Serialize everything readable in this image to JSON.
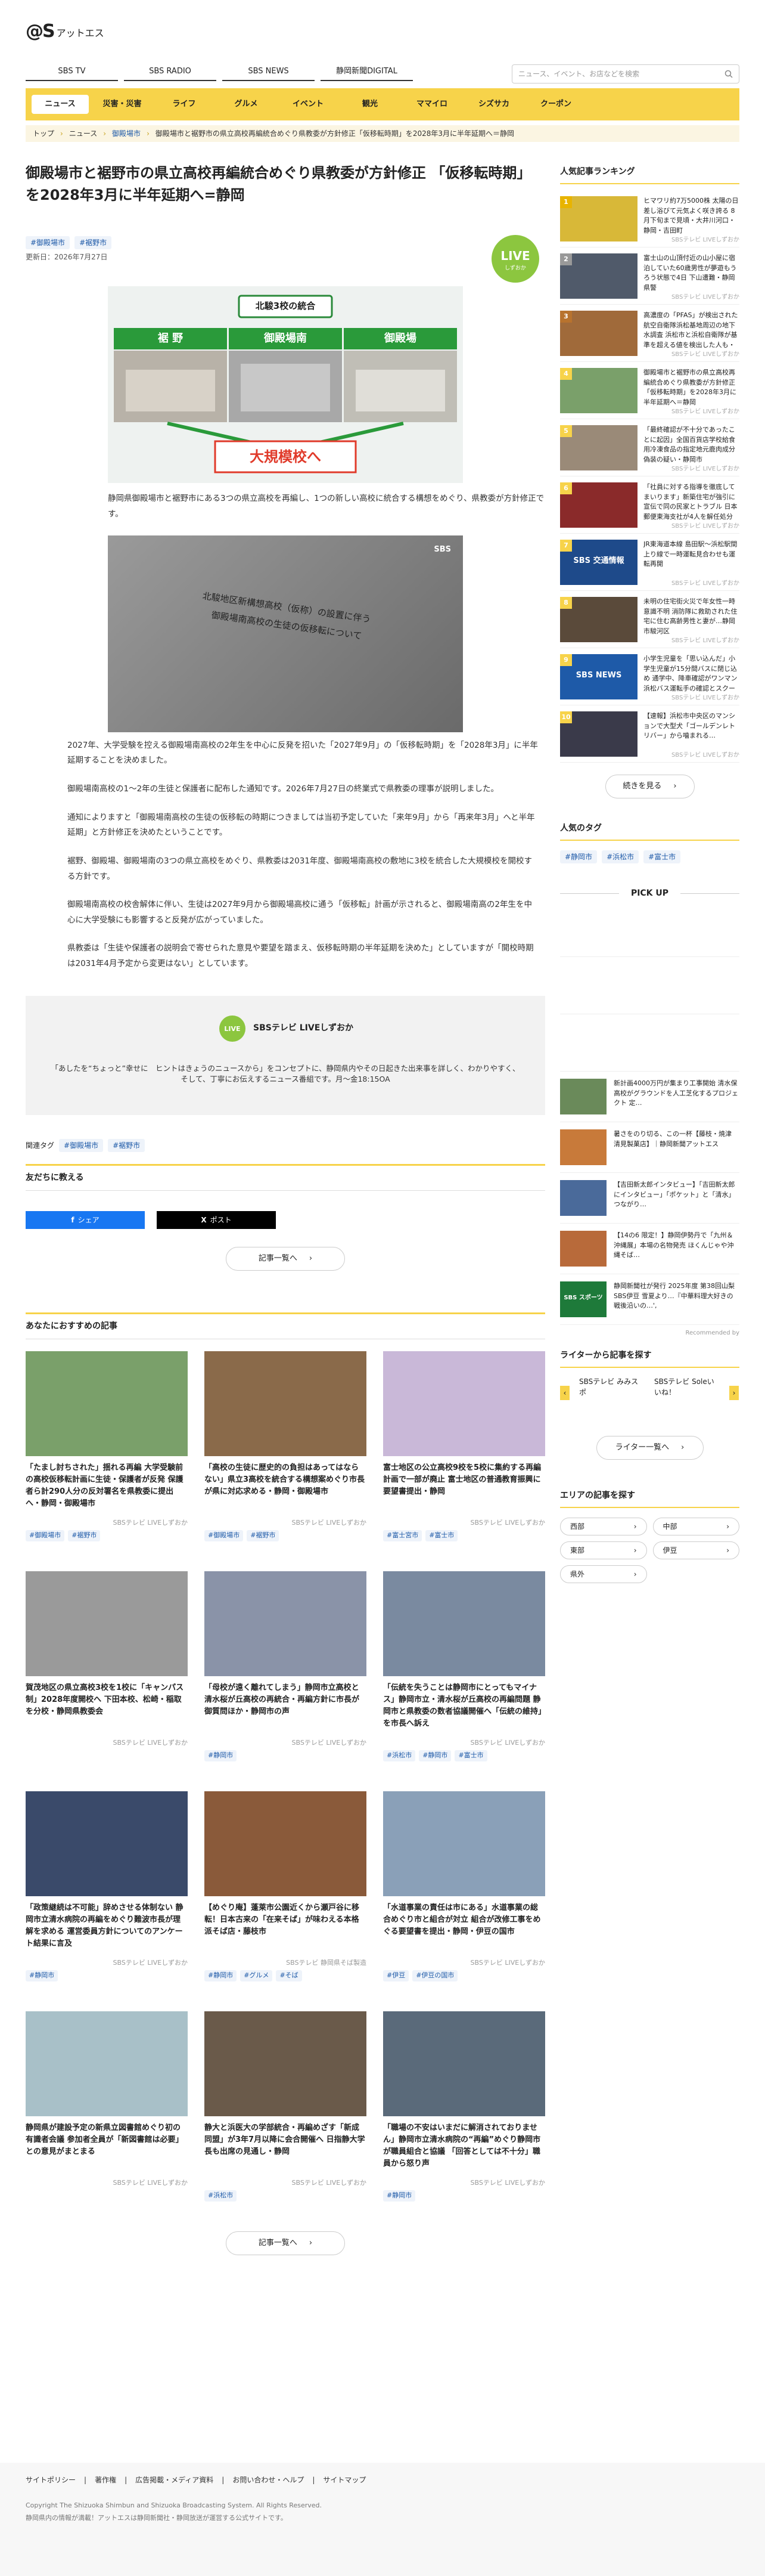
{
  "site": {
    "logo_mark": "@S",
    "logo_text": "アットエス"
  },
  "subnav": [
    "SBS TV",
    "SBS RADIO",
    "SBS NEWS",
    "静岡新聞DIGITAL"
  ],
  "search": {
    "placeholder": "ニュース、イベント、お店などを検索",
    "icon": "search-icon"
  },
  "mainnav": [
    "ニュース",
    "災害・災害",
    "ライフ",
    "グルメ",
    "イベント",
    "観光",
    "ママイロ",
    "シズサカ",
    "クーポン"
  ],
  "breadcrumb": [
    "トップ",
    "ニュース",
    "御殿場市",
    "御殿場市と裾野市の県立高校再編統合めぐり県教委が方針修正「仮移転時期」を2028年3月に半年延期へ＝静岡"
  ],
  "article": {
    "title": "御殿場市と裾野市の県立高校再編統合めぐり県教委が方針修正 「仮移転時期」を2028年3月に半年延期へ=静岡",
    "tags": [
      "#御殿場市",
      "#裾野市"
    ],
    "date": "更新日：2026年7月27日",
    "live_badge": "LIVE",
    "image1": {
      "header": "北駿3校の統合",
      "school_a": "裾 野",
      "school_b": "御殿場南",
      "school_c": "御殿場",
      "banner": "大規模校へ"
    },
    "caption1": "静岡県御殿場市と裾野市にある3つの県立高校を再編し、1つの新しい高校に統合する構想をめぐり、県教委が方針修正です。",
    "image2": {
      "watermark": "SBS",
      "doc_title": "北駿地区新構想高校（仮称）の設置に伴う",
      "doc_sub": "御殿場南高校の生徒の仮移転について"
    },
    "paragraphs": [
      "2027年、大学受験を控える御殿場南高校の2年生を中心に反発を招いた「2027年9月」の「仮移転時期」を「2028年3月」に半年延期することを決めました。",
      "御殿場南高校の1〜2年の生徒と保護者に配布した通知です。2026年7月27日の終業式で県教委の理事が説明しました。",
      "通知によりますと「御殿場南高校の生徒の仮移転の時期につきましては当初予定していた「来年9月」から「再来年3月」へと半年延期」と方針修正を決めたということです。",
      "裾野、御殿場、御殿場南の3つの県立高校をめぐり、県教委は2031年度、御殿場南高校の敷地に3校を統合した大規模校を開校する方針です。",
      "御殿場南高校の校舎解体に伴い、生徒は2027年9月から御殿場高校に通う「仮移転」計画が示されると、御殿場南高の2年生を中心に大学受験にも影響すると反発が広がっていました。",
      "県教委は「生徒や保護者の説明会で寄せられた意見や要望を踏まえ、仮移転時期の半年延期を決めた」としていますが「開校時期は2031年4月予定から変更はない」としています。"
    ],
    "livebox": {
      "title": "SBSテレビ LIVEしずおか",
      "text": "「あしたを“ちょっと”幸せに　ヒントはきょうのニュースから」をコンセプトに、静岡県内やその日起きた出来事を詳しく、わかりやすく、そして、丁寧にお伝えするニュース番組です。月〜金18:15OA"
    },
    "related_label": "関連タグ",
    "share_head": "友だちに教える",
    "share_fb": "シェア",
    "share_x": "ポスト",
    "more_label": "記事一覧へ"
  },
  "recommend": {
    "head": "あなたにおすすめの記事",
    "items": [
      {
        "title": "「たまし討ちされた」揺れる再編 大学受験前の高校仮移転計画に生徒・保護者が反発 保護者ら計290人分の反対署名を県教委に提出へ・静岡・御殿場市",
        "src": "SBSテレビ LIVEしずおか",
        "tags": [
          "#御殿場市",
          "#裾野市"
        ],
        "color": "#7aa06a"
      },
      {
        "title": "「高校の生徒に歴史的の負担はあってはならない」県立3高校を統合する構想案めぐり市長が県に対応求める・静岡・御殿場市",
        "src": "SBSテレビ LIVEしずおか",
        "tags": [
          "#御殿場市",
          "#裾野市"
        ],
        "color": "#8a6a4a"
      },
      {
        "title": "富士地区の公立高校9校を5校に集約する再編計画で一部が廃止 富士地区の普通教育振興に要望書提出・静岡",
        "src": "SBSテレビ LIVEしずおか",
        "tags": [
          "#富士宮市",
          "#富士市"
        ],
        "color": "#c9b8d8"
      },
      {
        "title": "賀茂地区の県立高校3校を1校に「キャンパス制」2028年度開校へ 下田本校、松崎・稲取を分校・静岡県教委会",
        "src": "SBSテレビ LIVEしずおか",
        "tags": [],
        "color": "#9a9a9a"
      },
      {
        "title": "「母校が遠く離れてしまう」静岡市立高校と清水桜が丘高校の再統合・再編方針に市長が 御質問ほか・静岡市の声",
        "src": "SBSテレビ LIVEしずおか",
        "tags": [
          "#静岡市"
        ],
        "color": "#8a93a8"
      },
      {
        "title": "「伝統を失うことは静岡市にとってもマイナス」静岡市立・清水桜が丘高校の再編問題 静岡市と県教委の数者協議開催へ「伝統の維持」を市長へ訴え",
        "src": "SBSテレビ LIVEしずおか",
        "tags": [
          "#浜松市",
          "#静岡市",
          "#富士市"
        ],
        "color": "#7a8aa0"
      },
      {
        "title": "「政策継続は不可能」辞めさせる体制ない 静岡市立清水病院の再編をめぐり難波市長が理解を求める 運営委員方針についてのアンケート結果に言及",
        "src": "SBSテレビ LIVEしずおか",
        "tags": [
          "#静岡市"
        ],
        "color": "#3a4a6a"
      },
      {
        "title": "【めぐり庵】蓬莱市公園近くから瀬戸谷に移転！日本古来の「在来そば」が味わえる本格派そば店・藤枝市",
        "src": "SBSテレビ 静岡県そば製造",
        "tags": [
          "#静岡市",
          "#グルメ",
          "#そば"
        ],
        "color": "#8a5a3a"
      },
      {
        "title": "「水道事業の責任は市にある」水道事業の総合めぐり市と組合が対立 組合が改修工事をめぐる要望書を提出・静岡・伊豆の国市",
        "src": "SBSテレビ LIVEしずおか",
        "tags": [
          "#伊豆",
          "#伊豆の国市"
        ],
        "color": "#8aa0b8"
      },
      {
        "title": "静岡県が建設予定の新県立図書館めぐり初の有識者会議 参加者全員が「新図書館は必要」との意見がまとまる",
        "src": "SBSテレビ LIVEしずおか",
        "tags": [],
        "color": "#a8c0c8"
      },
      {
        "title": "静大と浜医大の学部統合・再編めざす「新成同盟」が3年7月以降に会合開催へ 日指静大学長も出席の見通し・静岡",
        "src": "SBSテレビ LIVEしずおか",
        "tags": [
          "#浜松市"
        ],
        "color": "#6a5a4a"
      },
      {
        "title": "「職場の不安はいまだに解消されておりません」静岡市立清水病院の“再編”めぐり静岡市が職員組合と協議 「回答としては不十分」職員から怒り声",
        "src": "SBSテレビ LIVEしずおか",
        "tags": [
          "#静岡市"
        ],
        "color": "#5a6a7a"
      }
    ]
  },
  "sidebar": {
    "ranking_head": "人気記事ランキング",
    "ranking": [
      {
        "n": "1",
        "title": "ヒマワリ約7万5000株 太陽の日差し浴びて元気よく咲き誇る 8月下旬まで見頃・大井川河口・静岡・吉田町",
        "src": "SBSテレビ LIVEしずおか",
        "color": "#d8b838",
        "nbg": "#e8b400"
      },
      {
        "n": "2",
        "title": "富士山の山頂付近の山小屋に宿泊していた60歳男性が夢遊もうろう状態で4日 下山遭難・静岡県警",
        "src": "SBSテレビ LIVEしずおか",
        "color": "#505a6a",
        "nbg": "#999"
      },
      {
        "n": "3",
        "title": "高濃度の「PFAS」が検出された航空自衛隊浜松基地周辺の地下水調査 浜松市と浜松自衛隊が基準を超える値を検出した人も・静岡・浜松市",
        "src": "SBSテレビ LIVEしずおか",
        "color": "#a06a3a",
        "nbg": "#b8732e"
      },
      {
        "n": "4",
        "title": "御殿場市と裾野市の県立高校再編統合めぐり県教委が方針修正「仮移転時期」を2028年3月に半年延期へ＝静岡",
        "src": "SBSテレビ LIVEしずおか",
        "color": "#7aa06a",
        "nbg": "#f7d34a"
      },
      {
        "n": "5",
        "title": "「最終確認が不十分であったことに起因」全国百貨店学校給食用冷凍食品の指定地元鹿肉成分偽装の疑い・静岡市",
        "src": "SBSテレビ LIVEしずおか",
        "color": "#9a8a78",
        "nbg": "#f7d34a"
      },
      {
        "n": "6",
        "title": "「社員に対する指導を徹底してまいります」新築住宅が強引に宣伝で同の民家とトラブル 日本郵便東海支社が4人を解任処分",
        "src": "SBSテレビ LIVEしずおか",
        "color": "#8a2a2a",
        "nbg": "#f7d34a"
      },
      {
        "n": "7",
        "title": "JR東海道本線 島田駅〜浜松駅間 上り線で一時運転見合わせも運転再開",
        "src": "SBSテレビ LIVEしずおか",
        "color": "#1e4a8a",
        "nbg": "#f7d34a",
        "img_text": "SBS 交通情報"
      },
      {
        "n": "8",
        "title": "未明の住宅街火災で年女性一時意識不明 消防隊に救助された住宅に住む高齢男性と妻が…静岡市駿河区",
        "src": "SBSテレビ LIVEしずおか",
        "color": "#5a4a3a",
        "nbg": "#f7d34a"
      },
      {
        "n": "9",
        "title": "小学生児童を「思い込んだ」小学生児童が15分間バスに閉じ込め 通学中、降車確認がワンマン浜松バス運転手の確認とスクールバスで…清水区",
        "src": "SBSテレビ LIVEしずおか",
        "color": "#1e5aa8",
        "nbg": "#f7d34a",
        "img_text": "SBS NEWS"
      },
      {
        "n": "10",
        "title": "【速報】浜松市中央区のマンションで大型犬「ゴールデンレトリバー」から噛まれる…",
        "src": "SBSテレビ LIVEしずおか",
        "color": "#3a3a4a",
        "nbg": "#f7d34a"
      }
    ],
    "ranking_more": "続きを見る",
    "tags_head": "人気のタグ",
    "tags": [
      "#静岡市",
      "#浜松市",
      "#富士市"
    ],
    "pickup_head": "PICK UP",
    "pickup": [
      {
        "title": "新計画4000万円が集まり工事開始 清水保高校がグラウンドを人工芝化するプロジェクト 定…",
        "color": "#6a8a5a"
      },
      {
        "title": "暑さをのり切る、この一杯【藤枝・焼津 清見製菓店】｜静岡新聞アットエス",
        "color": "#c87a3a"
      },
      {
        "title": "【吉田新太郎インタビュー】「吉田新太郎にインタビュー」「ポケット」と「清水」つながり…",
        "color": "#4a6a9a"
      },
      {
        "title": "【14の6 限定！】静岡伊勢丹で「九州＆沖縄展」本場の名物発売 ほくんじゃや沖縄そば…",
        "color": "#b86a3a"
      },
      {
        "title": "静岡新聞社が発行 2025年度 第38回山梨SBS伊豆 雪夏より…『中華料理大好きの戦後沿いの…', ",
        "color": "#1e7a3a",
        "img_text": "SBS スポーツ"
      }
    ],
    "recommended_by": "Recommended by",
    "writer_head": "ライターから記事を探す",
    "writers": [
      "SBSテレビ みみスポ",
      "SBSテレビ Soleいいね！"
    ],
    "writer_more": "ライター一覧へ",
    "area_head": "エリアの記事を探す",
    "areas": [
      "西部",
      "中部",
      "東部",
      "伊豆",
      "県外"
    ]
  },
  "footer": {
    "links": [
      "サイトポリシー",
      "著作権",
      "広告掲載・メディア資料",
      "お問い合わせ・ヘルプ",
      "サイトマップ"
    ],
    "copyright": "Copyright The Shizuoka Shimbun and Shizuoka Broadcasting System. All Rights Reserved.",
    "note": "静岡県内の情報が満載！アットエスは静岡新聞社・静岡放送が運営する公式サイトです。"
  }
}
